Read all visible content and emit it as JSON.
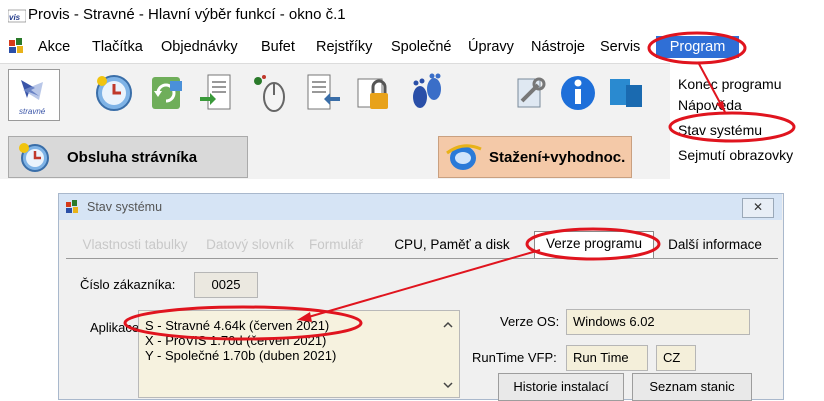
{
  "window": {
    "title": "Provis - Stravné - Hlavní výběr funkcí - okno č.1",
    "icon_text": "vis"
  },
  "menubar": {
    "items": [
      "Akce",
      "Tlačítka",
      "Objednávky",
      "Bufet",
      "Rejstříky",
      "Společné",
      "Úpravy",
      "Nástroje",
      "Servis",
      "Program"
    ]
  },
  "logo": {
    "label": "stravné"
  },
  "buttons": {
    "obsluha": "Obsluha strávníka",
    "stazeni": "Stažení+vyhodnoc."
  },
  "program_menu": {
    "items": [
      "Konec programu",
      "Nápověda",
      "Stav systému",
      "Sejmutí obrazovky"
    ]
  },
  "dialog": {
    "title": "Stav systému",
    "close_label": "✕",
    "tabs": [
      "Vlastnosti tabulky",
      "Datový slovník",
      "Formulář",
      "CPU, Paměť a disk",
      "Verze programu",
      "Další informace"
    ],
    "customer_label": "Číslo zákazníka:",
    "customer_value": "0025",
    "apps_label": "Aplikace:",
    "apps": [
      "S - Stravné 4.64k (červen 2021)",
      "X - ProVIS 1.70d (červen 2021)",
      "Y - Společné 1.70b (duben 2021)"
    ],
    "os_label": "Verze OS:",
    "os_value": "Windows 6.02",
    "runtime_label": "RunTime VFP:",
    "runtime_value": "Run Time",
    "lang_value": "CZ",
    "history_button": "Historie instalací",
    "stations_button": "Seznam stanic"
  },
  "colors": {
    "annotation_red": "#e0141e",
    "program_highlight": "#2f6fd6",
    "field_bg": "#f4efda"
  }
}
